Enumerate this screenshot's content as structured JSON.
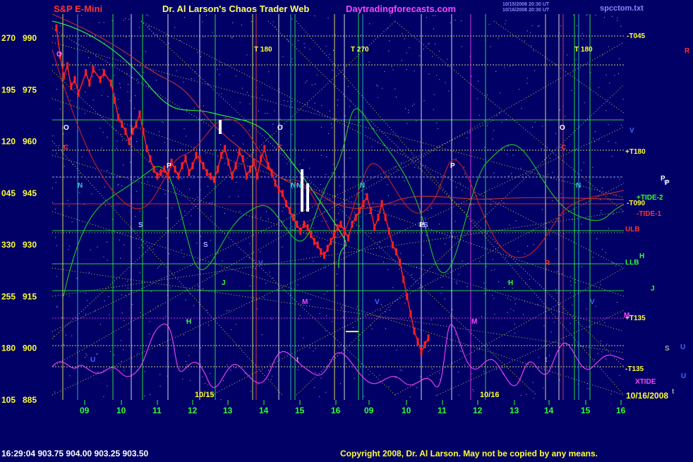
{
  "header": {
    "left_title": "S&P E-Mini",
    "center_title": "Dr. Al Larson's Chaos Trader Web",
    "site": "Daytradingforecasts.com",
    "timestamp_line1": "10/15/2008 20:30 UT",
    "timestamp_line2": "10/16/2008 20:30 UT",
    "file": "spcctom.txt"
  },
  "footer": {
    "quote": "16:29:04  903.75  904.00  903.25  903.50",
    "copyright": "Copyright 2008, Dr. Al Larson. May not be copied by any means."
  },
  "colors": {
    "background": "#000066",
    "price": "#ff2020",
    "green_line": "#22cc22",
    "red_line": "#cc2222",
    "magenta_line": "#ff44ff",
    "yellow_dots": "#dddd44",
    "title_red": "#ff3333",
    "site_magenta": "#ff44ff",
    "axis_yellow": "#ffff33",
    "axis_green": "#33ff33"
  },
  "chart_data": {
    "type": "line",
    "ylim": [
      885,
      997
    ],
    "y_ticks": [
      {
        "left": "270",
        "right": "990",
        "value": 990
      },
      {
        "left": "195",
        "right": "975",
        "value": 975
      },
      {
        "left": "120",
        "right": "960",
        "value": 960
      },
      {
        "left": "045",
        "right": "945",
        "value": 945
      },
      {
        "left": "330",
        "right": "930",
        "value": 930
      },
      {
        "left": "255",
        "right": "915",
        "value": 915
      },
      {
        "left": "180",
        "right": "900",
        "value": 900
      },
      {
        "left": "105",
        "right": "885",
        "value": 885
      }
    ],
    "x_hours": [
      "09",
      "10",
      "11",
      "12",
      "13",
      "14",
      "15",
      "16",
      "09",
      "10",
      "11",
      "12",
      "13",
      "14",
      "15",
      "16"
    ],
    "date_labels": [
      "10/15",
      "10/16"
    ],
    "date_right": "10/16/2008",
    "price_series": [
      [
        0.0,
        993
      ],
      [
        0.1,
        985
      ],
      [
        0.2,
        979
      ],
      [
        0.3,
        982
      ],
      [
        0.4,
        976
      ],
      [
        0.5,
        978
      ],
      [
        0.6,
        974
      ],
      [
        0.8,
        980
      ],
      [
        0.9,
        977
      ],
      [
        1.0,
        981
      ],
      [
        1.2,
        978
      ],
      [
        1.3,
        980
      ],
      [
        1.5,
        977
      ],
      [
        1.6,
        972
      ],
      [
        1.7,
        967
      ],
      [
        1.8,
        965
      ],
      [
        1.9,
        963
      ],
      [
        2.0,
        960
      ],
      [
        2.1,
        963
      ],
      [
        2.2,
        965
      ],
      [
        2.3,
        968
      ],
      [
        2.4,
        963
      ],
      [
        2.5,
        958
      ],
      [
        2.6,
        955
      ],
      [
        2.7,
        952
      ],
      [
        2.8,
        950
      ],
      [
        2.9,
        951
      ],
      [
        3.0,
        952
      ],
      [
        3.1,
        950
      ],
      [
        3.2,
        954
      ],
      [
        3.3,
        952
      ],
      [
        3.4,
        950
      ],
      [
        3.5,
        953
      ],
      [
        3.6,
        955
      ],
      [
        3.7,
        951
      ],
      [
        3.8,
        953
      ],
      [
        3.9,
        956
      ],
      [
        4.0,
        955
      ],
      [
        4.1,
        953
      ],
      [
        4.2,
        951
      ],
      [
        4.3,
        950
      ],
      [
        4.4,
        949
      ],
      [
        4.5,
        952
      ],
      [
        4.6,
        956
      ],
      [
        4.7,
        958
      ],
      [
        4.8,
        954
      ],
      [
        4.9,
        950
      ],
      [
        5.0,
        953
      ],
      [
        5.1,
        957
      ],
      [
        5.2,
        955
      ],
      [
        5.3,
        950
      ],
      [
        5.4,
        952
      ],
      [
        5.5,
        954
      ],
      [
        5.6,
        950
      ],
      [
        5.7,
        955
      ],
      [
        5.8,
        958
      ],
      [
        5.9,
        953
      ],
      [
        6.0,
        951
      ],
      [
        6.1,
        948
      ],
      [
        6.2,
        946
      ],
      [
        6.3,
        945
      ],
      [
        6.4,
        942
      ],
      [
        6.5,
        940
      ],
      [
        6.6,
        938
      ],
      [
        6.7,
        936
      ],
      [
        6.8,
        934
      ],
      [
        6.9,
        936
      ],
      [
        7.0,
        935
      ],
      [
        7.1,
        933
      ],
      [
        7.2,
        931
      ],
      [
        7.3,
        930
      ],
      [
        7.4,
        928
      ],
      [
        7.5,
        927
      ],
      [
        7.6,
        929
      ],
      [
        7.7,
        931
      ],
      [
        7.8,
        933
      ],
      [
        7.9,
        935
      ],
      [
        8.0,
        936
      ],
      [
        8.1,
        934
      ],
      [
        8.2,
        932
      ],
      [
        8.3,
        936
      ],
      [
        8.4,
        938
      ],
      [
        8.5,
        940
      ],
      [
        8.6,
        942
      ],
      [
        8.7,
        944
      ],
      [
        8.8,
        940
      ],
      [
        8.9,
        935
      ],
      [
        9.0,
        938
      ],
      [
        9.1,
        942
      ],
      [
        9.2,
        938
      ],
      [
        9.3,
        934
      ],
      [
        9.4,
        930
      ],
      [
        9.5,
        928
      ],
      [
        9.6,
        925
      ],
      [
        9.7,
        920
      ],
      [
        9.8,
        915
      ],
      [
        9.9,
        910
      ],
      [
        10.0,
        905
      ],
      [
        10.1,
        902
      ],
      [
        10.2,
        899
      ],
      [
        10.3,
        901
      ],
      [
        10.4,
        903
      ]
    ],
    "annotations": [
      {
        "text": "T 180",
        "color": "#ffff33"
      },
      {
        "text": "T 270",
        "color": "#ffff33"
      },
      {
        "text": "T 180",
        "color": "#ffff33"
      },
      {
        "text": "-T045",
        "color": "#ffff33"
      },
      {
        "text": "+T180",
        "color": "#ffff33"
      },
      {
        "text": "+TIDE-2",
        "color": "#33ff33"
      },
      {
        "text": "-T090",
        "color": "#ffff33"
      },
      {
        "text": "-TIDE-1",
        "color": "#ff3333"
      },
      {
        "text": "ULB",
        "color": "#ff3333"
      },
      {
        "text": "LLB",
        "color": "#33ff33"
      },
      {
        "text": "-T135",
        "color": "#ffff33"
      },
      {
        "text": "+T135",
        "color": "#ffff33"
      },
      {
        "text": "XTIDE",
        "color": "#ff44ff"
      },
      {
        "text": "O",
        "color": "#ffffff"
      },
      {
        "text": "O",
        "color": "#ffffff"
      },
      {
        "text": "O",
        "color": "#ffffff"
      },
      {
        "text": "C",
        "color": "#ff3333"
      },
      {
        "text": "C",
        "color": "#ff3333"
      },
      {
        "text": "C",
        "color": "#ff3333"
      },
      {
        "text": "N",
        "color": "#33cccc"
      },
      {
        "text": "N",
        "color": "#33cccc"
      },
      {
        "text": "N",
        "color": "#33cccc"
      },
      {
        "text": "N",
        "color": "#33cccc"
      },
      {
        "text": "N",
        "color": "#33cccc"
      },
      {
        "text": "P",
        "color": "#ffffff"
      },
      {
        "text": "P",
        "color": "#ffffff"
      },
      {
        "text": "P",
        "color": "#ffffff"
      },
      {
        "text": "S",
        "color": "#aaaaff"
      },
      {
        "text": "S",
        "color": "#aaaaff"
      },
      {
        "text": "S",
        "color": "#aaaaff"
      },
      {
        "text": "S",
        "color": "#aaaaff"
      },
      {
        "text": "J",
        "color": "#33ff33"
      },
      {
        "text": "J",
        "color": "#33ff33"
      },
      {
        "text": "H",
        "color": "#33ff33"
      },
      {
        "text": "H",
        "color": "#33ff33"
      },
      {
        "text": "H",
        "color": "#33ff33"
      },
      {
        "text": "M",
        "color": "#ff44ff"
      },
      {
        "text": "M",
        "color": "#ff44ff"
      },
      {
        "text": "M",
        "color": "#ff44ff"
      },
      {
        "text": "V",
        "color": "#4466ff"
      },
      {
        "text": "V",
        "color": "#4466ff"
      },
      {
        "text": "V",
        "color": "#4466ff"
      },
      {
        "text": "V",
        "color": "#4466ff"
      },
      {
        "text": "V",
        "color": "#4466ff"
      },
      {
        "text": "R",
        "color": "#ff3333"
      },
      {
        "text": "R",
        "color": "#ff3333"
      },
      {
        "text": "U",
        "color": "#4466ff"
      },
      {
        "text": "U",
        "color": "#4466ff"
      },
      {
        "text": "U",
        "color": "#4466ff"
      },
      {
        "text": "t",
        "color": "#aaaaaa"
      },
      {
        "text": "t",
        "color": "#aaaaaa"
      },
      {
        "text": "t",
        "color": "#aaaaaa"
      },
      {
        "text": "S",
        "color": "#aaaaaa"
      },
      {
        "text": "P",
        "color": "#ffffff"
      },
      {
        "text": "P",
        "color": "#ffffff"
      },
      {
        "text": "O",
        "color": "#ffffff"
      },
      {
        "text": "G",
        "color": "#ff44ff"
      }
    ]
  }
}
